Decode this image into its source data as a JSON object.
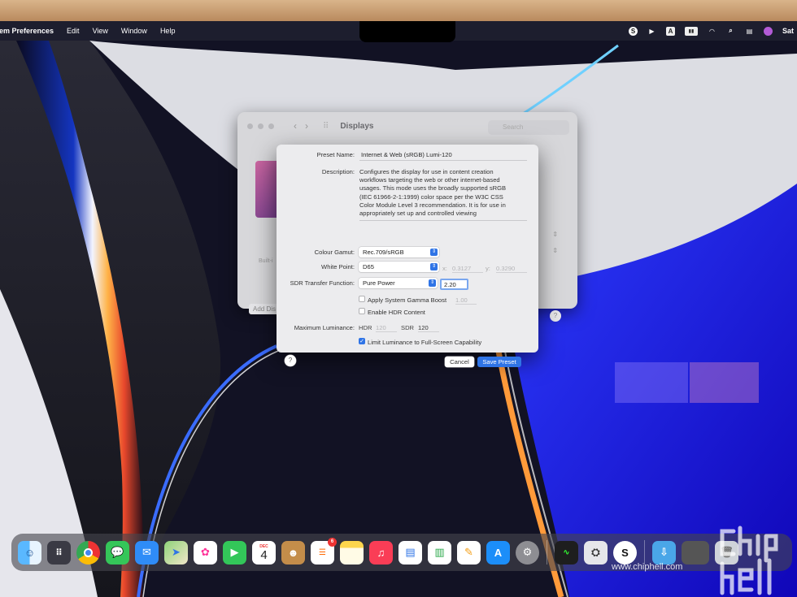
{
  "menubar": {
    "app_name": "tem Preferences",
    "items": [
      "Edit",
      "View",
      "Window",
      "Help"
    ],
    "clock": "Sat"
  },
  "displays_window": {
    "title": "Displays",
    "search_placeholder": "Search",
    "builtin_label": "Built-i",
    "add_display_label": "Add Dis",
    "help": "?"
  },
  "preset": {
    "name_label": "Preset Name:",
    "name_value": "Internet & Web (sRGB) Lumi-120",
    "description_label": "Description:",
    "description_lines": [
      "Configures the display for use in content creation",
      "workflows targeting the web or other internet-based",
      "usages. This mode uses the broadly supported sRGB",
      "(IEC 61966-2-1:1999) color space per the W3C CSS",
      "Color Module Level 3 recommendation. It is for use in",
      "appropriately set up and controlled viewing"
    ],
    "gamut_label": "Colour Gamut:",
    "gamut_value": "Rec.709/sRGB",
    "white_point_label": "White Point:",
    "white_point_value": "D65",
    "wp_x_label": "x:",
    "wp_x_value": "0.3127",
    "wp_y_label": "y:",
    "wp_y_value": "0.3290",
    "transfer_label": "SDR Transfer Function:",
    "transfer_value": "Pure Power",
    "gamma_value": "2.20",
    "apply_gamma_label": "Apply System Gamma Boost",
    "apply_gamma_checked": false,
    "gamma_boost_value": "1.00",
    "enable_hdr_label": "Enable HDR Content",
    "enable_hdr_checked": false,
    "max_luminance_label": "Maximum Luminance:",
    "hdr_label": "HDR",
    "hdr_value": "120",
    "sdr_label": "SDR",
    "sdr_value": "120",
    "limit_label": "Limit Luminance to Full-Screen Capability",
    "limit_checked": true,
    "help": "?",
    "cancel": "Cancel",
    "save": "Save Preset"
  },
  "dock": {
    "calendar_month": "DEC",
    "calendar_day": "4",
    "reminders_badge": "6"
  },
  "watermark": "www.chiphell.com",
  "colors": {
    "accent": "#2f74e6",
    "sheet_bg": "#ececee",
    "menubar_bg": "#1e2030"
  }
}
